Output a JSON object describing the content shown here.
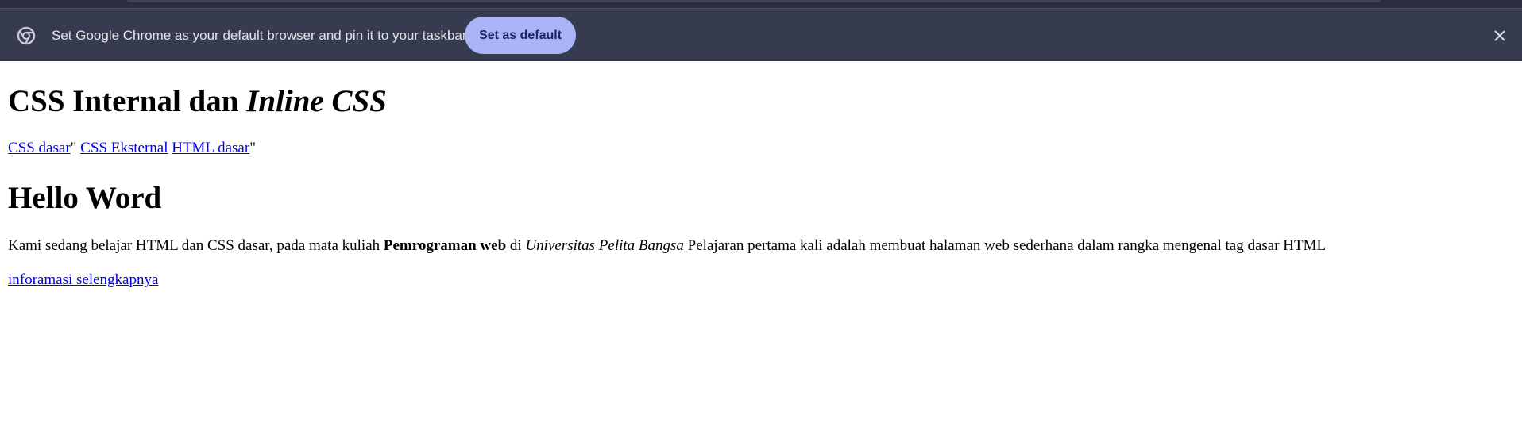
{
  "infobar": {
    "message": "Set Google Chrome as your default browser and pin it to your taskbar",
    "default_button_label": "Set as default",
    "icons": {
      "browser": "chrome-icon",
      "close": "close-icon"
    }
  },
  "content": {
    "heading_plain": "CSS Internal dan ",
    "heading_italic": "Inline CSS",
    "links": {
      "css_dasar": "CSS dasar",
      "sep1": "\" ",
      "css_eksternal": "CSS Eksternal",
      "sep2": " ",
      "html_dasar": "HTML dasar",
      "sep3": "\""
    },
    "subheading": "Hello Word",
    "paragraph": {
      "part1": "Kami sedang belajar HTML dan CSS dasar, pada mata kuliah ",
      "bold": "Pemrograman web",
      "part2": " di ",
      "italic": "Universitas Pelita Bangsa",
      "part3": " Pelajaran pertama kali adalah membuat halaman web sederhana dalam rangka mengenal tag dasar HTML"
    },
    "more_link": "inforamasi selengkapnya"
  },
  "colors": {
    "infobar_bg": "#373b4f",
    "button_bg": "#a9b4f9",
    "link": "#0000ee"
  }
}
